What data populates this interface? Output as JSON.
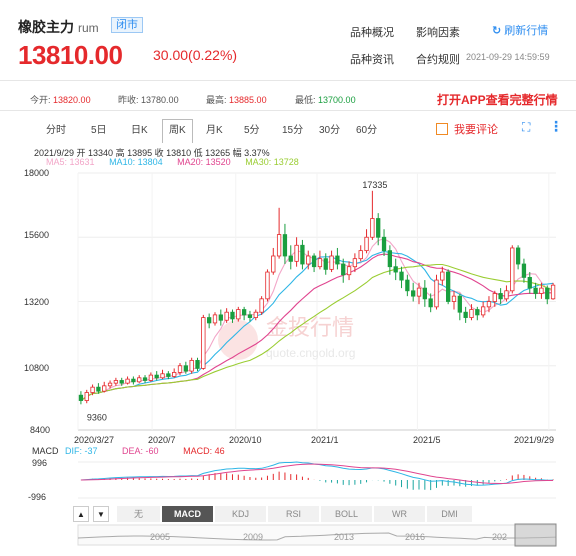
{
  "header": {
    "name": "橡胶主力",
    "code": "rum",
    "status": "闭市",
    "price": "13810.00",
    "change": "30.00(0.22%)",
    "links": [
      "品种概况",
      "影响因素",
      "品种资讯",
      "合约规则"
    ],
    "refresh": "刷新行情",
    "timestamp": "2021-09-29 14:59:59"
  },
  "quote": {
    "open_label": "今开:",
    "open": "13820.00",
    "prev_label": "昨收:",
    "prev": "13780.00",
    "high_label": "最高:",
    "high": "13885.00",
    "low_label": "最低:",
    "low": "13700.00",
    "cta": "打开APP查看完整行情"
  },
  "tabs": [
    "分时",
    "5日",
    "日K",
    "周K",
    "月K",
    "5分",
    "15分",
    "30分",
    "60分"
  ],
  "active_tab": "周K",
  "toolbar": {
    "comment": "我要评论",
    "fullscreen": "⛶",
    "more": "⋮"
  },
  "info_line": "2021/9/29  开 13340  高 13895  收 13810  低 13265  幅 3.37%",
  "ma": [
    {
      "label": "MA5: 13631",
      "color": "#f2a6c8"
    },
    {
      "label": "MA10: 13804",
      "color": "#2fb6e6"
    },
    {
      "label": "MA20: 13520",
      "color": "#e0458f"
    },
    {
      "label": "MA30: 13728",
      "color": "#9acd32"
    }
  ],
  "watermark": {
    "brand": "金投行情",
    "url": "quote.cngold.org"
  },
  "chart_data": {
    "type": "candlestick",
    "y_ticks": [
      "18000",
      "15600",
      "13200",
      "10800",
      "8400"
    ],
    "ylim": [
      8400,
      18000
    ],
    "x_ticks": [
      "2020/3/27",
      "2020/7",
      "2020/10",
      "2021/1",
      "2021/5",
      "2021/9/29"
    ],
    "annotations": {
      "max": "17335",
      "min": "9360"
    },
    "candles": [
      {
        "o": 9700,
        "c": 9500,
        "h": 9850,
        "l": 9360
      },
      {
        "o": 9500,
        "c": 9800,
        "h": 9900,
        "l": 9400
      },
      {
        "o": 9800,
        "c": 10000,
        "h": 10100,
        "l": 9700
      },
      {
        "o": 10000,
        "c": 9850,
        "h": 10150,
        "l": 9750
      },
      {
        "o": 9850,
        "c": 10050,
        "h": 10200,
        "l": 9800
      },
      {
        "o": 10050,
        "c": 10150,
        "h": 10250,
        "l": 9950
      },
      {
        "o": 10150,
        "c": 10250,
        "h": 10350,
        "l": 10050
      },
      {
        "o": 10250,
        "c": 10150,
        "h": 10350,
        "l": 10050
      },
      {
        "o": 10150,
        "c": 10300,
        "h": 10400,
        "l": 10100
      },
      {
        "o": 10300,
        "c": 10200,
        "h": 10400,
        "l": 10100
      },
      {
        "o": 10200,
        "c": 10350,
        "h": 10450,
        "l": 10150
      },
      {
        "o": 10350,
        "c": 10250,
        "h": 10450,
        "l": 10150
      },
      {
        "o": 10250,
        "c": 10450,
        "h": 10550,
        "l": 10200
      },
      {
        "o": 10450,
        "c": 10350,
        "h": 10600,
        "l": 10250
      },
      {
        "o": 10350,
        "c": 10500,
        "h": 10650,
        "l": 10300
      },
      {
        "o": 10500,
        "c": 10400,
        "h": 10600,
        "l": 10300
      },
      {
        "o": 10400,
        "c": 10550,
        "h": 10700,
        "l": 10350
      },
      {
        "o": 10550,
        "c": 10800,
        "h": 10900,
        "l": 10450
      },
      {
        "o": 10800,
        "c": 10600,
        "h": 10950,
        "l": 10500
      },
      {
        "o": 10600,
        "c": 11000,
        "h": 11100,
        "l": 10500
      },
      {
        "o": 11000,
        "c": 10700,
        "h": 11100,
        "l": 10600
      },
      {
        "o": 10700,
        "c": 12600,
        "h": 12700,
        "l": 10650
      },
      {
        "o": 12600,
        "c": 12400,
        "h": 12750,
        "l": 12200
      },
      {
        "o": 12400,
        "c": 12700,
        "h": 12800,
        "l": 12300
      },
      {
        "o": 12700,
        "c": 12500,
        "h": 12900,
        "l": 12300
      },
      {
        "o": 12500,
        "c": 12800,
        "h": 12950,
        "l": 12400
      },
      {
        "o": 12800,
        "c": 12550,
        "h": 12900,
        "l": 12400
      },
      {
        "o": 12550,
        "c": 12900,
        "h": 13000,
        "l": 12450
      },
      {
        "o": 12900,
        "c": 12700,
        "h": 13000,
        "l": 12500
      },
      {
        "o": 12700,
        "c": 12600,
        "h": 12850,
        "l": 12450
      },
      {
        "o": 12600,
        "c": 12800,
        "h": 12900,
        "l": 12500
      },
      {
        "o": 12800,
        "c": 13300,
        "h": 13400,
        "l": 12700
      },
      {
        "o": 13300,
        "c": 14300,
        "h": 14400,
        "l": 13200
      },
      {
        "o": 14300,
        "c": 14900,
        "h": 15200,
        "l": 14200
      },
      {
        "o": 14900,
        "c": 15700,
        "h": 16700,
        "l": 14800
      },
      {
        "o": 15700,
        "c": 14900,
        "h": 16100,
        "l": 14600
      },
      {
        "o": 14900,
        "c": 14700,
        "h": 15300,
        "l": 14400
      },
      {
        "o": 14700,
        "c": 15300,
        "h": 15600,
        "l": 14500
      },
      {
        "o": 15300,
        "c": 14600,
        "h": 15500,
        "l": 14400
      },
      {
        "o": 14600,
        "c": 14900,
        "h": 15100,
        "l": 14400
      },
      {
        "o": 14900,
        "c": 14500,
        "h": 15000,
        "l": 14300
      },
      {
        "o": 14500,
        "c": 14800,
        "h": 15100,
        "l": 14400
      },
      {
        "o": 14800,
        "c": 14400,
        "h": 15000,
        "l": 14200
      },
      {
        "o": 14400,
        "c": 14900,
        "h": 15100,
        "l": 14300
      },
      {
        "o": 14900,
        "c": 14600,
        "h": 15200,
        "l": 14400
      },
      {
        "o": 14600,
        "c": 14200,
        "h": 14800,
        "l": 13900
      },
      {
        "o": 14200,
        "c": 14500,
        "h": 14700,
        "l": 14000
      },
      {
        "o": 14500,
        "c": 14800,
        "h": 15000,
        "l": 14300
      },
      {
        "o": 14800,
        "c": 15100,
        "h": 15300,
        "l": 14700
      },
      {
        "o": 15100,
        "c": 15600,
        "h": 15900,
        "l": 15000
      },
      {
        "o": 15600,
        "c": 16300,
        "h": 17335,
        "l": 15500
      },
      {
        "o": 16300,
        "c": 15600,
        "h": 16500,
        "l": 15300
      },
      {
        "o": 15600,
        "c": 15100,
        "h": 15900,
        "l": 14900
      },
      {
        "o": 15100,
        "c": 14500,
        "h": 15300,
        "l": 14200
      },
      {
        "o": 14500,
        "c": 14300,
        "h": 14800,
        "l": 14000
      },
      {
        "o": 14300,
        "c": 14000,
        "h": 14500,
        "l": 13700
      },
      {
        "o": 14000,
        "c": 13600,
        "h": 14200,
        "l": 13400
      },
      {
        "o": 13600,
        "c": 13400,
        "h": 13900,
        "l": 13200
      },
      {
        "o": 13400,
        "c": 13700,
        "h": 13900,
        "l": 13100
      },
      {
        "o": 13700,
        "c": 13300,
        "h": 14000,
        "l": 13000
      },
      {
        "o": 13300,
        "c": 13000,
        "h": 13500,
        "l": 12800
      },
      {
        "o": 13000,
        "c": 14000,
        "h": 14200,
        "l": 12900
      },
      {
        "o": 14000,
        "c": 14300,
        "h": 14500,
        "l": 13800
      },
      {
        "o": 14300,
        "c": 13200,
        "h": 14400,
        "l": 13100
      },
      {
        "o": 13200,
        "c": 13400,
        "h": 13600,
        "l": 12900
      },
      {
        "o": 13400,
        "c": 12800,
        "h": 13500,
        "l": 12500
      },
      {
        "o": 12800,
        "c": 12600,
        "h": 13000,
        "l": 12400
      },
      {
        "o": 12600,
        "c": 12900,
        "h": 13100,
        "l": 12500
      },
      {
        "o": 12900,
        "c": 12700,
        "h": 13000,
        "l": 12500
      },
      {
        "o": 12700,
        "c": 13000,
        "h": 13200,
        "l": 12600
      },
      {
        "o": 13000,
        "c": 13200,
        "h": 13400,
        "l": 12800
      },
      {
        "o": 13200,
        "c": 13500,
        "h": 13600,
        "l": 13000
      },
      {
        "o": 13500,
        "c": 13300,
        "h": 13700,
        "l": 13100
      },
      {
        "o": 13300,
        "c": 13600,
        "h": 13800,
        "l": 13200
      },
      {
        "o": 13600,
        "c": 15200,
        "h": 15300,
        "l": 13500
      },
      {
        "o": 15200,
        "c": 14600,
        "h": 15300,
        "l": 14400
      },
      {
        "o": 14600,
        "c": 14100,
        "h": 14800,
        "l": 13900
      },
      {
        "o": 14100,
        "c": 13700,
        "h": 14300,
        "l": 13500
      },
      {
        "o": 13700,
        "c": 13500,
        "h": 13900,
        "l": 13300
      },
      {
        "o": 13500,
        "c": 13700,
        "h": 13900,
        "l": 13300
      },
      {
        "o": 13700,
        "c": 13300,
        "h": 13800,
        "l": 13100
      },
      {
        "o": 13300,
        "c": 13810,
        "h": 13895,
        "l": 13265
      }
    ]
  },
  "macd": {
    "label": "MACD",
    "dif": "DIF: -37",
    "dea": "DEA: -60",
    "macd": "MACD: 46",
    "ticks": [
      "996",
      "-996"
    ]
  },
  "indicator_tabs": [
    "无",
    "MACD",
    "KDJ",
    "RSI",
    "BOLL",
    "WR",
    "DMI"
  ],
  "active_indicator": "MACD",
  "navigator": {
    "years": [
      "2005",
      "2009",
      "2013",
      "2016",
      "202"
    ]
  }
}
